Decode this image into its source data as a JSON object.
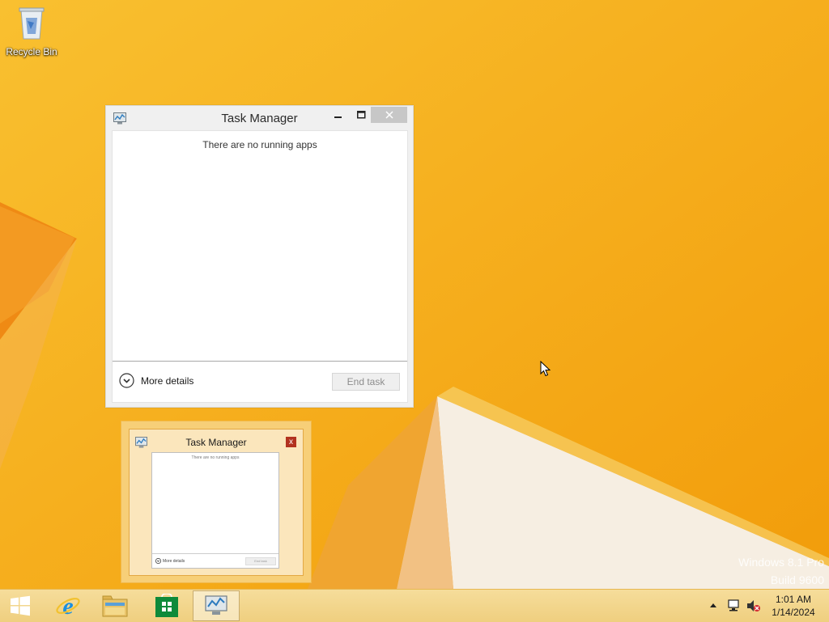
{
  "desktop": {
    "recycle_bin_label": "Recycle Bin",
    "watermark": {
      "line1": "Windows 8.1 Pro",
      "line2": "Build 9600"
    }
  },
  "task_manager": {
    "title": "Task Manager",
    "empty_message": "There are no running apps",
    "more_details_label": "More details",
    "end_task_label": "End task",
    "end_task_enabled": false
  },
  "preview": {
    "title": "Task Manager",
    "close_glyph": "x",
    "thumb_text": "There are no running apps",
    "thumb_more": "More details",
    "thumb_end": "End task"
  },
  "taskbar": {
    "pinned": [
      {
        "icon": "windows-start-icon"
      },
      {
        "icon": "internet-explorer-icon"
      },
      {
        "icon": "file-explorer-icon"
      },
      {
        "icon": "windows-store-icon"
      },
      {
        "icon": "task-manager-icon",
        "active": true
      }
    ],
    "tray": {
      "icons": [
        "show-hidden-icons-chevron",
        "network-icon",
        "volume-muted-icon"
      ],
      "time": "1:01 AM",
      "date": "1/14/2024"
    }
  },
  "colors": {
    "wallpaper": "#f6a80f",
    "taskbar": "#f3d58a",
    "close_button": "#c7c7c7",
    "preview_close": "#b2321f"
  }
}
